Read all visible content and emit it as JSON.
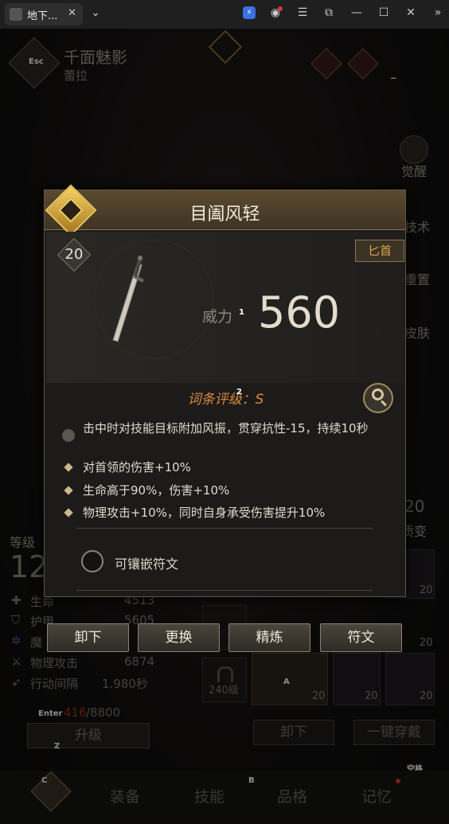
{
  "browser": {
    "tab_title": "地下...",
    "tab_close": "✕",
    "dropdown": "⌄",
    "icons": [
      "extension-icon",
      "profile-icon",
      "menu-icon",
      "screenshot-icon",
      "minimize-icon",
      "maximize-icon",
      "close-icon",
      "sidebar-icon"
    ]
  },
  "hud": {
    "esc_key": "Esc",
    "character_name": "千面魅影",
    "character_sub": "蕾拉",
    "tilde_key": "~",
    "right_tabs": [
      "觉醒",
      "技术",
      "重置",
      "皮肤"
    ],
    "level_label": "等级",
    "level_value": "12",
    "stats": [
      {
        "name": "生命",
        "value": "4513"
      },
      {
        "name": "护甲",
        "value": "5605"
      },
      {
        "name": "魔",
        "value": ""
      },
      {
        "name": "物理攻击",
        "value": "6874"
      },
      {
        "name": "行动间隔",
        "value": "1.980秒"
      }
    ],
    "exp_current": "416",
    "exp_max": "/8800",
    "enter_key": "Enter",
    "upgrade_button": "升级",
    "z_key": "Z",
    "lock_label": "240级",
    "a_key": "A",
    "unequip_button": "卸下",
    "equip_all_button": "一键穿戴",
    "space_key": "空格",
    "slot_levels": [
      "20",
      "20",
      "20",
      "20",
      "20"
    ],
    "right_level": "20",
    "right_level_label": "质变"
  },
  "dialog": {
    "title": "目阖风轻",
    "item_level": "20",
    "weapon_type": "匕首",
    "power_label": "威力",
    "power_marker": "1",
    "power_value": "560",
    "rating_label": "词条评级：",
    "rating_marker": "2",
    "rating_value": "S",
    "locked_affix": "击中时对技能目标附加风振，贯穿抗性-15，持续10秒",
    "affixes": [
      "对首领的伤害+10%",
      "生命高于90%，伤害+10%",
      "物理攻击+10%，同时自身承受伤害提升10%"
    ],
    "rune_label": "可镶嵌符文",
    "buttons": [
      "卸下",
      "更换",
      "精炼",
      "符文"
    ]
  },
  "bottom_nav": {
    "c_key": "C",
    "b_key": "B",
    "items": [
      "装备",
      "技能",
      "品格",
      "记忆"
    ]
  },
  "colors": {
    "accent": "#e2a44a",
    "rating": "#e08a3a",
    "exp": "#c0392b"
  }
}
